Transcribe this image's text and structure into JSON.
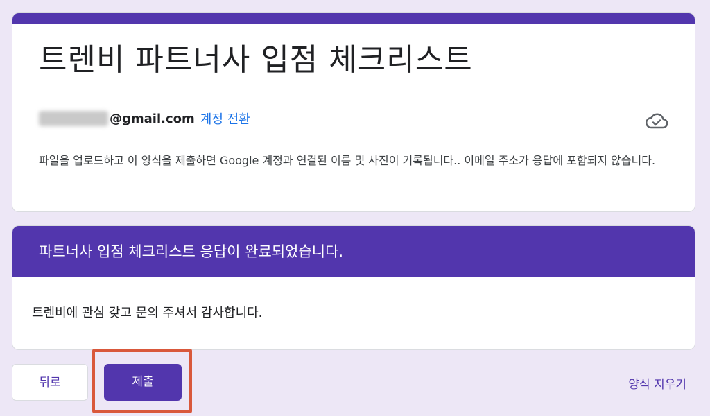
{
  "form": {
    "title": "트렌비 파트너사 입점 체크리스트"
  },
  "account": {
    "email_domain": "@gmail.com",
    "switch_label": "계정 전환"
  },
  "info": {
    "text": "파일을 업로드하고 이 양식을 제출하면 Google 계정과 연결된 이름 및 사진이 기록됩니다.. 이메일 주소가 응답에 포함되지 않습니다."
  },
  "confirmation": {
    "header": "파트너사 입점 체크리스트 응답이 완료되었습니다.",
    "message": "트렌비에 관심 갖고 문의 주셔서 감사합니다."
  },
  "actions": {
    "back_label": "뒤로",
    "submit_label": "제출",
    "clear_label": "양식 지우기"
  },
  "icons": {
    "cloud": "cloud-done-icon"
  },
  "colors": {
    "accent": "#5236ad",
    "link": "#1a73e8",
    "background": "#ede7f6",
    "highlight": "#d9583b"
  }
}
